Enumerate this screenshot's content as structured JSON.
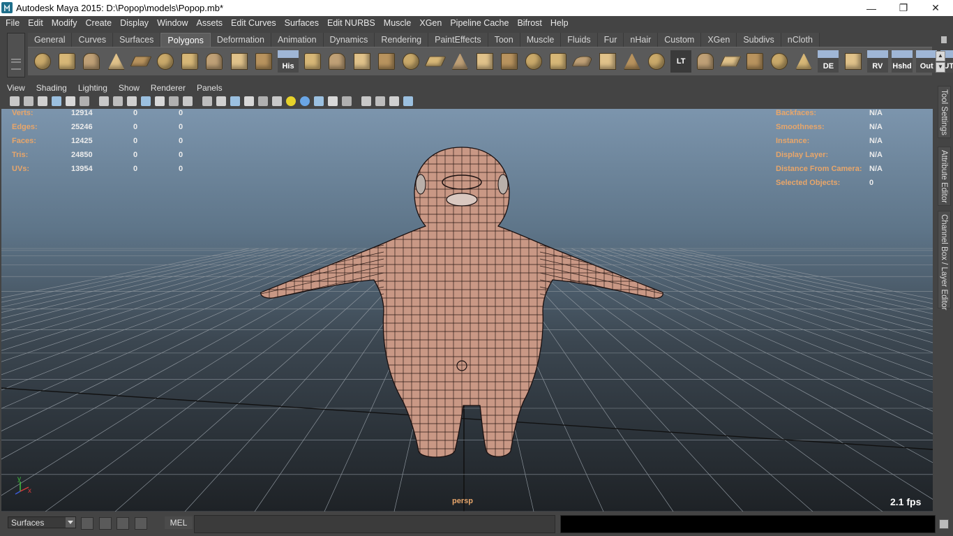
{
  "window": {
    "title": "Autodesk Maya 2015: D:\\Popop\\models\\Popop.mb*",
    "minimize": "—",
    "restore": "❐",
    "close": "✕"
  },
  "menu": [
    "File",
    "Edit",
    "Modify",
    "Create",
    "Display",
    "Window",
    "Assets",
    "Edit Curves",
    "Surfaces",
    "Edit NURBS",
    "Muscle",
    "XGen",
    "Pipeline Cache",
    "Bifrost",
    "Help"
  ],
  "shelf_tabs": [
    "General",
    "Curves",
    "Surfaces",
    "Polygons",
    "Deformation",
    "Animation",
    "Dynamics",
    "Rendering",
    "PaintEffects",
    "Toon",
    "Muscle",
    "Fluids",
    "Fur",
    "nHair",
    "Custom",
    "XGen",
    "Subdivs",
    "nCloth"
  ],
  "active_shelf_tab": "Polygons",
  "shelf_icons": [
    {
      "icon": "sphere-icon"
    },
    {
      "icon": "cube-icon"
    },
    {
      "icon": "cylinder-icon"
    },
    {
      "icon": "cone-icon"
    },
    {
      "icon": "plane-icon"
    },
    {
      "icon": "torus-icon"
    },
    {
      "icon": "pyramid-icon"
    },
    {
      "icon": "pipe-icon"
    },
    {
      "icon": "soccer-icon"
    },
    {
      "icon": "helix-icon"
    },
    {
      "icon": "history-icon",
      "label": "His"
    },
    {
      "icon": "combine-icon"
    },
    {
      "icon": "separate-icon"
    },
    {
      "icon": "extract-icon"
    },
    {
      "icon": "smooth-icon"
    },
    {
      "icon": "bridge-icon"
    },
    {
      "icon": "extrude-icon"
    },
    {
      "icon": "merge-icon"
    },
    {
      "icon": "bevel-icon"
    },
    {
      "icon": "append-icon"
    },
    {
      "icon": "split-icon"
    },
    {
      "icon": "paint-icon"
    },
    {
      "icon": "wireframe-cube-icon"
    },
    {
      "icon": "target-icon"
    },
    {
      "icon": "sculpt-icon"
    },
    {
      "icon": "render-icon"
    },
    {
      "icon": "lt-icon",
      "label": "LT"
    },
    {
      "icon": "uv-icon"
    },
    {
      "icon": "uv-cut-icon"
    },
    {
      "icon": "uv-sew-icon"
    },
    {
      "icon": "uv-select-icon"
    },
    {
      "icon": "uv-unfold-icon"
    },
    {
      "icon": "de-icon",
      "label": "DE"
    },
    {
      "icon": "uv-layout-icon"
    },
    {
      "icon": "rv-icon",
      "label": "RV"
    },
    {
      "icon": "hshd-icon",
      "label": "Hshd"
    },
    {
      "icon": "out-icon",
      "label": "Out"
    },
    {
      "icon": "ute-icon",
      "label": "UTE"
    }
  ],
  "panel_menu": [
    "View",
    "Shading",
    "Lighting",
    "Show",
    "Renderer",
    "Panels"
  ],
  "hud_left": [
    {
      "label": "Verts:",
      "v1": "12914",
      "v2": "0",
      "v3": "0"
    },
    {
      "label": "Edges:",
      "v1": "25246",
      "v2": "0",
      "v3": "0"
    },
    {
      "label": "Faces:",
      "v1": "12425",
      "v2": "0",
      "v3": "0"
    },
    {
      "label": "Tris:",
      "v1": "24850",
      "v2": "0",
      "v3": "0"
    },
    {
      "label": "UVs:",
      "v1": "13954",
      "v2": "0",
      "v3": "0"
    }
  ],
  "hud_right": [
    {
      "label": "Backfaces:",
      "value": "N/A"
    },
    {
      "label": "Smoothness:",
      "value": "N/A"
    },
    {
      "label": "Instance:",
      "value": "N/A"
    },
    {
      "label": "Display Layer:",
      "value": "N/A"
    },
    {
      "label": "Distance From Camera:",
      "value": "N/A"
    },
    {
      "label": "Selected Objects:",
      "value": "0"
    }
  ],
  "axis": {
    "y": "y",
    "x": "x"
  },
  "camera": "persp",
  "fps": "2.1 fps",
  "side_tabs": [
    "Tool Settings",
    "Attribute Editor",
    "Channel Box / Layer Editor"
  ],
  "bottom": {
    "mode": "Surfaces",
    "mel": "MEL",
    "command": "",
    "command_placeholder": ""
  },
  "colors": {
    "hud_label": "#e8a66a",
    "skin": "#c99885",
    "viewport_top": "#7c95ad",
    "viewport_bottom": "#1e2226"
  }
}
